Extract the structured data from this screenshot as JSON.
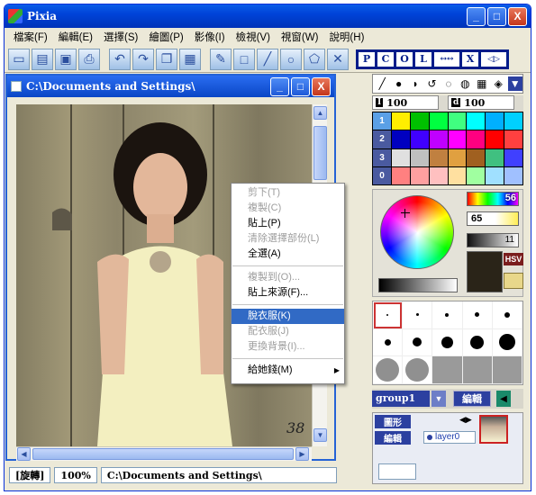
{
  "window": {
    "title": "Pixia",
    "controls": [
      "_",
      "□",
      "X"
    ]
  },
  "menu": [
    "檔案(F)",
    "編輯(E)",
    "選擇(S)",
    "繪圖(P)",
    "影像(I)",
    "檢視(V)",
    "視窗(W)",
    "說明(H)"
  ],
  "toolbar": {
    "pcol": [
      "P",
      "C",
      "O",
      "L"
    ],
    "pcol_extra": [
      "↔↔",
      "X",
      "◁▷"
    ]
  },
  "document": {
    "title": "C:\\Documents and Settings\\",
    "corner_label": "38"
  },
  "context_menu": {
    "items": [
      {
        "label": "剪下(T)",
        "disabled": true
      },
      {
        "label": "複製(C)",
        "disabled": true
      },
      {
        "label": "貼上(P)",
        "disabled": false
      },
      {
        "label": "清除選擇部份(L)",
        "disabled": true
      },
      {
        "label": "全選(A)",
        "disabled": false
      },
      {
        "label": "複製到(O)...",
        "disabled": true
      },
      {
        "label": "貼上來源(F)...",
        "disabled": false
      },
      {
        "label": "脫衣服(K)",
        "disabled": false,
        "selected": true
      },
      {
        "label": "配衣服(J)",
        "disabled": true
      },
      {
        "label": "更換背景(I)...",
        "disabled": true
      },
      {
        "label": "給她錢(M)",
        "disabled": false,
        "submenu": true
      }
    ]
  },
  "status": {
    "mode": "[旋轉]",
    "zoom": "100%",
    "path": "C:\\Documents and Settings\\"
  },
  "panel": {
    "size_a": "100",
    "size_b": "100",
    "palette_rows": [
      "1",
      "2",
      "3",
      "0"
    ],
    "hue_value": "56",
    "saturation_value": "65",
    "lightness_value": "11",
    "hsv_label": "HSV",
    "group_label": "group1",
    "edit_label": "編輯",
    "layer_buttons": [
      "圖形",
      "編輯"
    ],
    "layer_name": "layer0",
    "layer_arrows": "◀▶"
  },
  "colors": {
    "accent": "#0043d8",
    "menu_selection": "#316ac5",
    "palette": [
      [
        "#ffee00",
        "#00c000",
        "#00ff40",
        "#40ff80",
        "#00ffff",
        "#00b0ff",
        "#00d0ff"
      ],
      [
        "#0000c0",
        "#4000ff",
        "#c000ff",
        "#ff00ff",
        "#ff0080",
        "#ff0000",
        "#ff4040"
      ],
      [
        "#e0e0e0",
        "#c0c0c0",
        "#c08040",
        "#e0a040",
        "#a06020",
        "#40c080",
        "#4040ff"
      ],
      [
        "#ff8080",
        "#ffa0a0",
        "#ffc0c0",
        "#ffe0a0",
        "#a0ffa0",
        "#a0e0ff",
        "#a0c0ff"
      ]
    ]
  }
}
